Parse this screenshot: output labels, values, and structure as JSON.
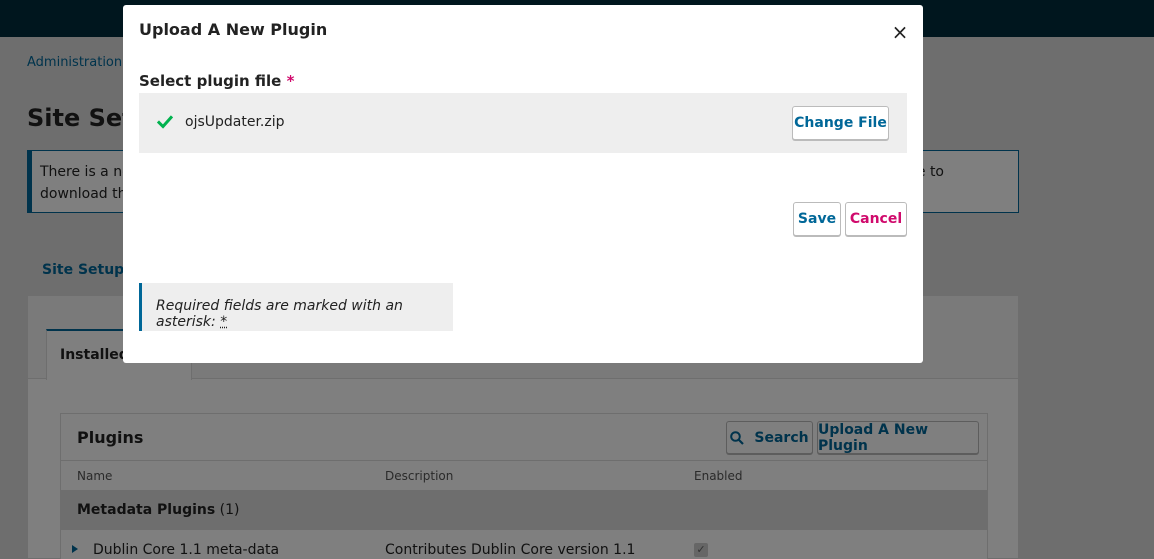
{
  "breadcrumb": {
    "item1": "Administration"
  },
  "page": {
    "title": "Site Sett",
    "notice": {
      "left_line1": "There is a ne",
      "left_line2": "download th",
      "right_text": "e to"
    },
    "tab_site_setup": "Site Setup",
    "subtab_installed": "Installed"
  },
  "plugins_grid": {
    "title": "Plugins",
    "search_label": "Search",
    "upload_label": "Upload A New Plugin",
    "columns": [
      "Name",
      "Description",
      "Enabled"
    ],
    "category": {
      "name": "Metadata Plugins",
      "count": "(1)"
    },
    "rows": [
      {
        "name": "Dublin Core 1.1 meta-data",
        "description": "Contributes Dublin Core version 1.1",
        "enabled": true
      }
    ]
  },
  "modal": {
    "title": "Upload A New Plugin",
    "close_glyph": "×",
    "field_label": "Select plugin file",
    "required_mark": "*",
    "file_name": "ojsUpdater.zip",
    "change_file_label": "Change File",
    "save_label": "Save",
    "cancel_label": "Cancel",
    "required_note_text": "Required fields are marked with an asterisk:",
    "required_note_star": "*"
  },
  "colors": {
    "accent": "#006798",
    "danger": "#d00a6c",
    "success": "#00b24e",
    "topbar": "#002c3d"
  },
  "icons": {
    "close": "close-icon",
    "check": "check-icon",
    "search": "search-icon",
    "expand": "triangle-right-icon"
  }
}
